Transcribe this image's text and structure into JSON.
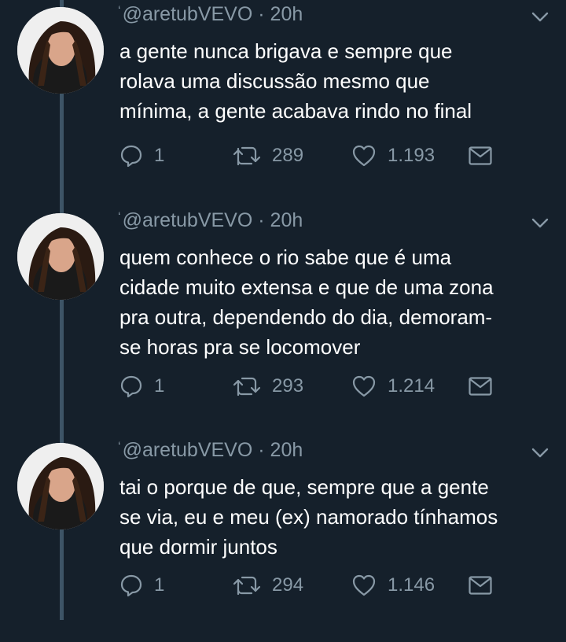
{
  "colors": {
    "background": "#15202b",
    "text": "#ffffff",
    "secondary": "#8899a6",
    "thread_line": "#3d5466"
  },
  "tweets": [
    {
      "handle": "@aretubVEVO",
      "separator": "·",
      "time": "20h",
      "text_lines": [
        "a gente nunca brigava e sempre que",
        "rolava uma discussão mesmo que",
        "mínima, a gente acabava rindo no final"
      ],
      "replies": "1",
      "retweets": "289",
      "likes": "1.193",
      "icons": [
        "reply-icon",
        "retweet-icon",
        "like-icon",
        "direct-message-icon",
        "chevron-down-icon"
      ]
    },
    {
      "handle": "@aretubVEVO",
      "separator": "·",
      "time": "20h",
      "text_lines": [
        "quem conhece o rio sabe que é uma",
        "cidade muito extensa e que de uma zona",
        "pra outra, dependendo do dia, demoram-",
        "se horas pra se locomover"
      ],
      "replies": "1",
      "retweets": "293",
      "likes": "1.214",
      "icons": [
        "reply-icon",
        "retweet-icon",
        "like-icon",
        "direct-message-icon",
        "chevron-down-icon"
      ]
    },
    {
      "handle": "@aretubVEVO",
      "separator": "·",
      "time": "20h",
      "text_lines": [
        "tai o porque de que, sempre que a gente",
        "se via, eu e meu (ex) namorado tínhamos",
        "que dormir juntos"
      ],
      "replies": "1",
      "retweets": "294",
      "likes": "1.146",
      "icons": [
        "reply-icon",
        "retweet-icon",
        "like-icon",
        "direct-message-icon",
        "chevron-down-icon"
      ]
    }
  ]
}
